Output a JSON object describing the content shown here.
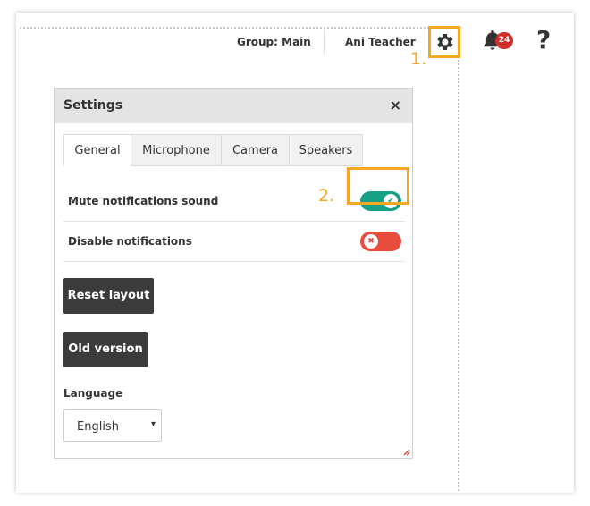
{
  "topbar": {
    "group": "Group: Main",
    "user": "Ani Teacher",
    "notification_count": "24",
    "help": "?",
    "icons": [
      "gear-icon",
      "bell-icon",
      "help-icon"
    ]
  },
  "annotations": {
    "step1": "1.",
    "step2": "2.",
    "highlight_color": "#f5a623"
  },
  "settings": {
    "title": "Settings",
    "close": "×",
    "tabs": [
      "General",
      "Microphone",
      "Camera",
      "Speakers"
    ],
    "active_tab": "General",
    "toggles": [
      {
        "label": "Mute notifications sound",
        "state": "on",
        "color": "#16a085",
        "icon": "✔"
      },
      {
        "label": "Disable notifications",
        "state": "off",
        "color": "#e74c3c",
        "icon": "✖"
      }
    ],
    "buttons": {
      "reset": "Reset layout",
      "old": "Old version"
    },
    "language": {
      "label": "Language",
      "value": "English",
      "arrow": "▾"
    }
  }
}
